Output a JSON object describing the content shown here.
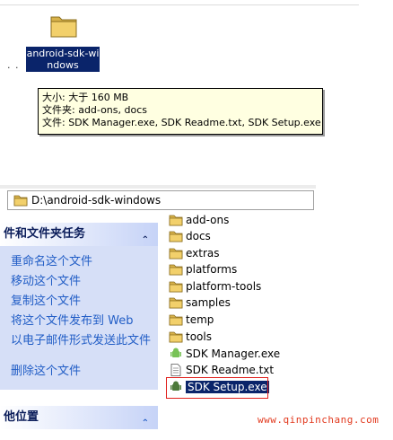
{
  "top_folder": {
    "label_line1": "android-sdk-wi",
    "label_line2": "ndows",
    "dots": ". ."
  },
  "tooltip": {
    "size_line": "大小: 大于 160 MB",
    "folders_line": "文件夹: add-ons, docs",
    "files_line": "文件: SDK Manager.exe, SDK Readme.txt, SDK Setup.exe"
  },
  "address_bar": {
    "path": "D:\\android-sdk-windows"
  },
  "task_pane": {
    "title": "件和文件夹任务",
    "items": [
      "重命名这个文件",
      "移动这个文件",
      "复制这个文件",
      "将这个文件发布到 Web",
      "以电子邮件形式发送此文件",
      "删除这个文件"
    ]
  },
  "places_pane": {
    "title": "他位置"
  },
  "files": [
    {
      "name": "add-ons",
      "type": "folder"
    },
    {
      "name": "docs",
      "type": "folder"
    },
    {
      "name": "extras",
      "type": "folder"
    },
    {
      "name": "platforms",
      "type": "folder"
    },
    {
      "name": "platform-tools",
      "type": "folder"
    },
    {
      "name": "samples",
      "type": "folder"
    },
    {
      "name": "temp",
      "type": "folder"
    },
    {
      "name": "tools",
      "type": "folder"
    },
    {
      "name": "SDK Manager.exe",
      "type": "android-exe"
    },
    {
      "name": "SDK Readme.txt",
      "type": "text"
    },
    {
      "name": "SDK Setup.exe",
      "type": "android-exe",
      "selected": true
    }
  ],
  "chevron_glyph": "⌃",
  "watermark": "www.qinpinchang.com",
  "colors": {
    "selection": "#0a246a",
    "task_pane_bg": "#d6dff7",
    "link_blue": "#215dc6",
    "highlight_border": "#e0201c",
    "tooltip_bg": "#ffffe1",
    "folder_yellow": "#f2c94c"
  }
}
